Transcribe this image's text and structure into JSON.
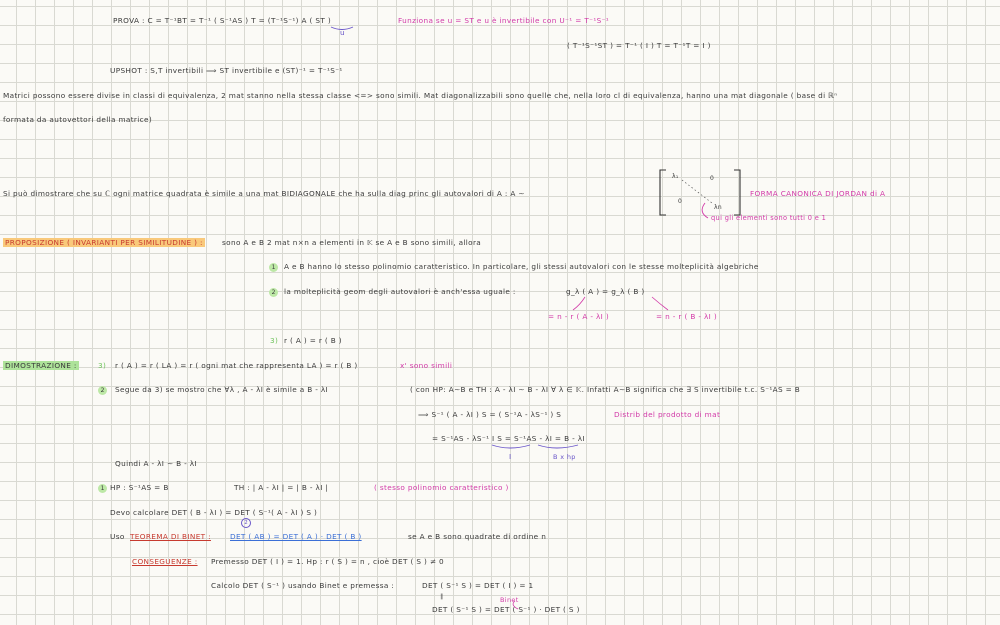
{
  "lines": {
    "prova": "PROVA :   C =  T⁻¹BT  =  T⁻¹ ( S⁻¹AS ) T  =  (T⁻¹S⁻¹) A ( ST )",
    "prova_u": "u",
    "prova_note": "Funziona se  u = ST   e   u è invertibile   con  U⁻¹ = T⁻¹S⁻¹",
    "prova_check": "( T⁻¹S⁻¹ST )  =  T⁻¹ ( I ) T   =  T⁻¹T  =  I )",
    "upshot": "UPSHOT :   S,T invertibili   ⟹  ST invertibile  e  (ST)⁻¹ = T⁻¹S⁻¹",
    "para1": "Matrici possono essere divise in classi di equivalenza, 2 mat stanno nella stessa classe  <=>  sono simili.  Mat diagonalizzabili sono quelle che, nella loro cl di equivalenza, hanno una mat diagonale  ( base di ℝⁿ",
    "para2": "formata da autovettori della matrice)",
    "jordan_text": "Si può dimostrare che su ℂ  ogni matrice quadrata  è simile a una mat BIDIAGONALE  che ha sulla diag princ gli autovalori  di A :       A ∼",
    "jordan_l1": "λ₁",
    "jordan_ln": "λn",
    "jordan_zero_top": "0",
    "jordan_zero_bottom": "0",
    "jordan_label": "FORMA CANONICA DI JORDAN  di A",
    "jordan_note": "qui gli elementi sono tutti  0 e 1",
    "prop_title": "PROPOSIZIONE ( INVARIANTI PER SIMILITUDINE ) :",
    "prop_text": "sono A e B  2 mat  n×n   a elementi in 𝕂   se  A e B  sono simili, allora",
    "prop_1": "A e B  hanno lo stesso polinomio caratteristico. In particolare, gli stessi autovalori   con le stesse molteplicità algebriche",
    "prop_2": "la molteplicità geom degli autovalori è anch'essa uguale :",
    "prop_2_formula": "g_λ ( A ) = g_λ ( B )",
    "prop_2_left": "= n - r ( A - λI )",
    "prop_2_right": "= n - r ( B - λI )",
    "prop_3": "r ( A ) = r ( B )",
    "n1": "1",
    "n2": "2",
    "n3": "3)",
    "dim_title": "DIMOSTRAZIONE :",
    "dim_3_num": "3)",
    "dim_3": "r ( A )  =  r ( LA )  = r ( ogni mat  che rappresenta LA )  =  r ( B )",
    "dim_3_note": "x' sono simili",
    "dim_2": "Segue da  3)  se mostro che ∀λ ,  A - λI  è simile a  B - λI",
    "dim_2_hp": "( con HP: A∼B  e  TH :  A - λI  ∼  B - λI    ∀ λ ∈ 𝕂.  Infatti  A∼B  significa che ∃ S invertibile  t.c.  S⁻¹AS = B",
    "dim_2_l1": "⟹  S⁻¹ ( A - λI ) S  =  ( S⁻¹A  - λS⁻¹ ) S",
    "dim_2_distr": "Distrib del prodotto di mat",
    "dim_2_l2": "=  S⁻¹AS  -  λS⁻¹ I S      =  S⁻¹AS  - λI    =  B - λI",
    "dim_2_I": "I",
    "dim_2_hpnote": "B x hp",
    "quindi": "Quindi   A - λI  ∼  B - λI",
    "dim_1_hp": "HP :   S⁻¹AS = B",
    "dim_1_th": "TH :   | A - λI |  =  | B - λI |",
    "dim_1_note": "( stesso polinomio caratteristico )",
    "devo": "Devo calcolare   DET ( B - λI )   =    DET ( S⁻¹( A - λI ) S )",
    "devo_circ": "2",
    "uso_prefix": "Uso",
    "uso_binet": "TEOREMA DI BINET :",
    "uso_formula": "DET ( AB ) = DET ( A ) · DET ( B )",
    "uso_suffix": "se  A e B   sono quadrate  di ordine n",
    "cons_title": "CONSEGUENZE :",
    "cons_text": "Premesso  DET ( I ) = 1.    Hp :  r ( S ) = n ,  cioè  DET ( S ) ≠ 0",
    "calcolo": "Calcolo DET ( S⁻¹ )  usando  Binet e premessa :",
    "calcolo_eq": "DET ( S⁻¹ S )  =  DET ( I )  =  1",
    "calcolo_parallel": "∥",
    "calcolo_binet": "Binet",
    "calcolo_eq2": "DET ( S⁻¹ S )  =  DET ( S⁻¹ ) · DET ( S )"
  }
}
